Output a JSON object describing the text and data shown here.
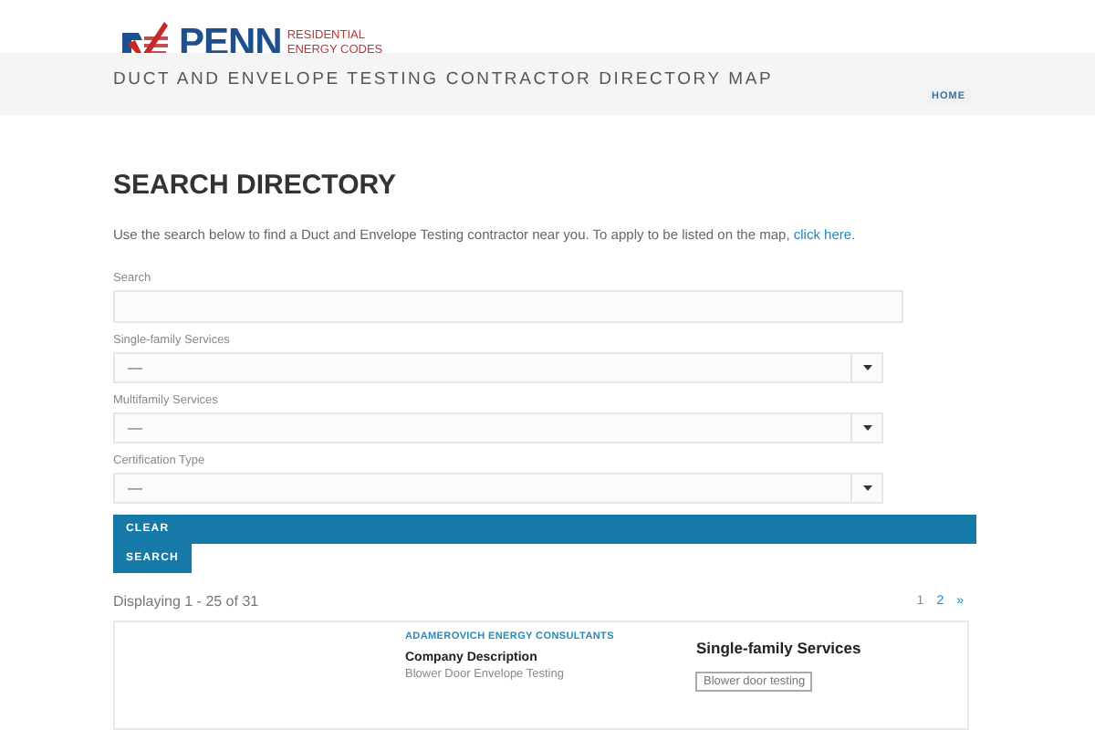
{
  "logo": {
    "name": "PENN",
    "tagline": [
      "RESIDENTIAL",
      "ENERGY CODES"
    ]
  },
  "banner": {
    "title": "DUCT AND ENVELOPE TESTING CONTRACTOR DIRECTORY MAP",
    "nav": [
      {
        "label": "HOME",
        "selected": true
      }
    ]
  },
  "heading": "SEARCH DIRECTORY",
  "intro": {
    "text": "Use the search below to find a Duct and Envelope Testing contractor near you. To apply to be listed on the map, ",
    "link": "click here."
  },
  "fields": [
    {
      "kind": "text",
      "label": "Search"
    },
    {
      "kind": "select",
      "label": "Single-family Services",
      "value": "—"
    },
    {
      "kind": "select",
      "label": "Multifamily Services",
      "value": "—"
    },
    {
      "kind": "select",
      "label": "Certification Type",
      "value": "—"
    }
  ],
  "buttons": [
    "CLEAR",
    "SEARCH"
  ],
  "results": {
    "summary": "Displaying 1 - 25 of 31",
    "pages": [
      {
        "label": "1",
        "selected": true
      },
      {
        "label": "2",
        "selected": false
      },
      {
        "label": "»",
        "selected": false
      }
    ]
  },
  "listing": {
    "company": "ADAMEROVICH ENERGY CONSULTANTS",
    "description_title": "Company Description",
    "description": "Blower Door Envelope Testing",
    "services_title": "Single-family Services",
    "tags": [
      "Blower door testing"
    ]
  }
}
